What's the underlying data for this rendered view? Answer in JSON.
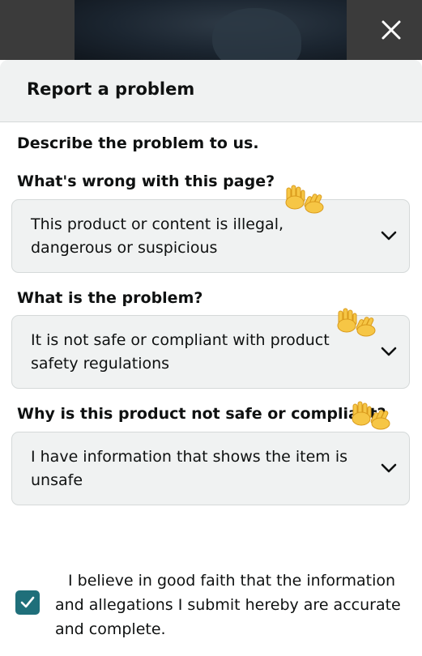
{
  "header": {
    "title": "Report a problem"
  },
  "intro": "Describe the problem to us.",
  "questions": [
    {
      "label": "What's wrong with this page?",
      "value": "This product or content is illegal, dangerous or suspicious"
    },
    {
      "label": "What is the problem?",
      "value": "It is not safe or compliant with product safety regulations"
    },
    {
      "label": "Why is this product not safe or compliant?",
      "value": "I have information that shows the item is unsafe"
    }
  ],
  "consent": {
    "checked": true,
    "text": "I believe in good faith that the information and allegations I submit hereby are accurate and complete."
  },
  "icons": {
    "close": "close-icon",
    "dropdown": "chevron-down-icon",
    "checkbox": "checkmark-icon",
    "annotation": "waving-hands-emoji"
  },
  "colors": {
    "header_bg": "#f0f2f2",
    "dropdown_bg": "#f0f2f2",
    "checkbox_accent": "#1f6f7a",
    "text": "#0f1111"
  }
}
